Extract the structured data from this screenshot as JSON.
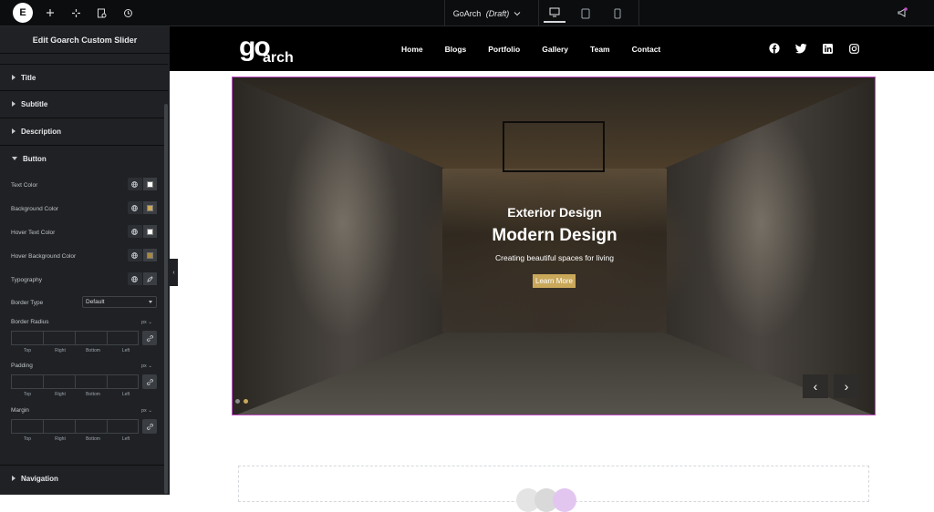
{
  "topbar": {
    "document_title": "GoArch",
    "document_status": "(Draft)",
    "logo_letter": "E"
  },
  "panel": {
    "header": "Edit Goarch Custom Slider",
    "sections": [
      {
        "label": "Title",
        "expanded": false
      },
      {
        "label": "Subtitle",
        "expanded": false
      },
      {
        "label": "Description",
        "expanded": false
      },
      {
        "label": "Button",
        "expanded": true
      },
      {
        "label": "Navigation",
        "expanded": false
      }
    ],
    "controls": {
      "text_color": {
        "label": "Text Color",
        "swatch": "#ffffff"
      },
      "background_color": {
        "label": "Background Color",
        "swatch": "#c9a85a"
      },
      "hover_text_color": {
        "label": "Hover Text Color",
        "swatch": "#ffffff"
      },
      "hover_background_color": {
        "label": "Hover Background Color",
        "swatch": "#a8893f"
      },
      "typography": {
        "label": "Typography"
      },
      "border_type": {
        "label": "Border Type",
        "value": "Default"
      },
      "border_radius": {
        "label": "Border Radius",
        "unit": "px"
      },
      "padding": {
        "label": "Padding",
        "unit": "px"
      },
      "margin": {
        "label": "Margin",
        "unit": "px"
      }
    },
    "dim_labels": [
      "Top",
      "Right",
      "Bottom",
      "Left"
    ]
  },
  "site": {
    "brand_go": "go",
    "brand_arch": "arch",
    "nav": [
      "Home",
      "Blogs",
      "Portfolio",
      "Gallery",
      "Team",
      "Contact"
    ],
    "social_icons": [
      "facebook-icon",
      "twitter-icon",
      "linkedin-icon",
      "instagram-icon"
    ]
  },
  "slide": {
    "subtitle": "Exterior Design",
    "title": "Modern Design",
    "description": "Creating beautiful spaces for living",
    "button": "Learn More",
    "prev": "‹",
    "next": "›",
    "dot_colors": [
      "#8a8a8a",
      "#c9a85a"
    ]
  },
  "colors": {
    "accent": "#c9a85a",
    "selection": "#c04dc4"
  }
}
